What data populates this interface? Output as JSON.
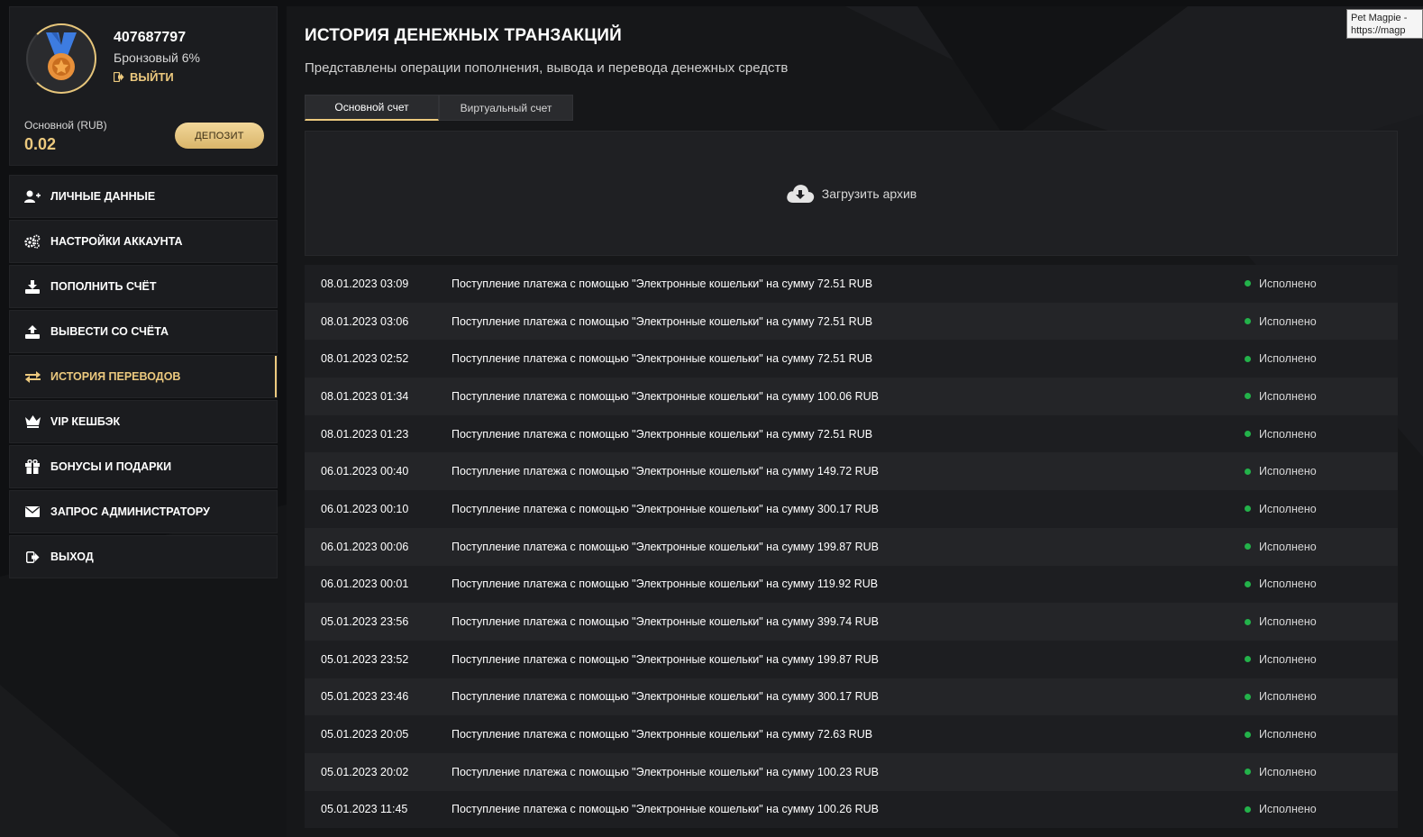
{
  "profile": {
    "user_id": "407687797",
    "level": "Бронзовый 6%",
    "logout_label": "ВЫЙТИ",
    "balance_label": "Основной (RUB)",
    "balance_value": "0.02",
    "deposit_label": "ДЕПОЗИТ"
  },
  "menu": [
    {
      "label": "ЛИЧНЫЕ ДАННЫЕ",
      "icon": "user-plus-icon"
    },
    {
      "label": "НАСТРОЙКИ АККАУНТА",
      "icon": "gears-icon"
    },
    {
      "label": "ПОПОЛНИТЬ СЧЁТ",
      "icon": "download-icon"
    },
    {
      "label": "ВЫВЕСТИ СО СЧЁТА",
      "icon": "upload-icon"
    },
    {
      "label": "ИСТОРИЯ ПЕРЕВОДОВ",
      "icon": "exchange-icon",
      "active": true
    },
    {
      "label": "VIP КЕШБЭК",
      "icon": "crown-icon"
    },
    {
      "label": "БОНУСЫ И ПОДАРКИ",
      "icon": "gift-icon"
    },
    {
      "label": "ЗАПРОС АДМИНИСТРАТОРУ",
      "icon": "envelope-icon"
    },
    {
      "label": "ВЫХОД",
      "icon": "sign-out-icon"
    }
  ],
  "main": {
    "title": "ИСТОРИЯ ДЕНЕЖНЫХ ТРАНЗАКЦИЙ",
    "subtitle": "Представлены операции пополнения, вывода и перевода денежных средств",
    "tabs": [
      {
        "label": "Основной счет",
        "active": true
      },
      {
        "label": "Виртуальный счет",
        "active": false
      }
    ],
    "archive_label": "Загрузить архив"
  },
  "transactions": [
    {
      "date": "08.01.2023 03:09",
      "desc": "Поступление платежа с помощью \"Электронные кошельки\" на сумму 72.51 RUB",
      "status": "Исполнено"
    },
    {
      "date": "08.01.2023 03:06",
      "desc": "Поступление платежа с помощью \"Электронные кошельки\" на сумму 72.51 RUB",
      "status": "Исполнено"
    },
    {
      "date": "08.01.2023 02:52",
      "desc": "Поступление платежа с помощью \"Электронные кошельки\" на сумму 72.51 RUB",
      "status": "Исполнено"
    },
    {
      "date": "08.01.2023 01:34",
      "desc": "Поступление платежа с помощью \"Электронные кошельки\" на сумму 100.06 RUB",
      "status": "Исполнено"
    },
    {
      "date": "08.01.2023 01:23",
      "desc": "Поступление платежа с помощью \"Электронные кошельки\" на сумму 72.51 RUB",
      "status": "Исполнено"
    },
    {
      "date": "06.01.2023 00:40",
      "desc": "Поступление платежа с помощью \"Электронные кошельки\" на сумму 149.72 RUB",
      "status": "Исполнено"
    },
    {
      "date": "06.01.2023 00:10",
      "desc": "Поступление платежа с помощью \"Электронные кошельки\" на сумму 300.17 RUB",
      "status": "Исполнено"
    },
    {
      "date": "06.01.2023 00:06",
      "desc": "Поступление платежа с помощью \"Электронные кошельки\" на сумму 199.87 RUB",
      "status": "Исполнено"
    },
    {
      "date": "06.01.2023 00:01",
      "desc": "Поступление платежа с помощью \"Электронные кошельки\" на сумму 119.92 RUB",
      "status": "Исполнено"
    },
    {
      "date": "05.01.2023 23:56",
      "desc": "Поступление платежа с помощью \"Электронные кошельки\" на сумму 399.74 RUB",
      "status": "Исполнено"
    },
    {
      "date": "05.01.2023 23:52",
      "desc": "Поступление платежа с помощью \"Электронные кошельки\" на сумму 199.87 RUB",
      "status": "Исполнено"
    },
    {
      "date": "05.01.2023 23:46",
      "desc": "Поступление платежа с помощью \"Электронные кошельки\" на сумму 300.17 RUB",
      "status": "Исполнено"
    },
    {
      "date": "05.01.2023 20:05",
      "desc": "Поступление платежа с помощью \"Электронные кошельки\" на сумму 72.63 RUB",
      "status": "Исполнено"
    },
    {
      "date": "05.01.2023 20:02",
      "desc": "Поступление платежа с помощью \"Электронные кошельки\" на сумму 100.23 RUB",
      "status": "Исполнено"
    },
    {
      "date": "05.01.2023 11:45",
      "desc": "Поступление платежа с помощью \"Электронные кошельки\" на сумму 100.26 RUB",
      "status": "Исполнено"
    }
  ],
  "tooltip": {
    "line1": "Pet Magpie -",
    "line2": "https://magp"
  },
  "colors": {
    "accent": "#ecc97e",
    "success": "#23b24a"
  }
}
